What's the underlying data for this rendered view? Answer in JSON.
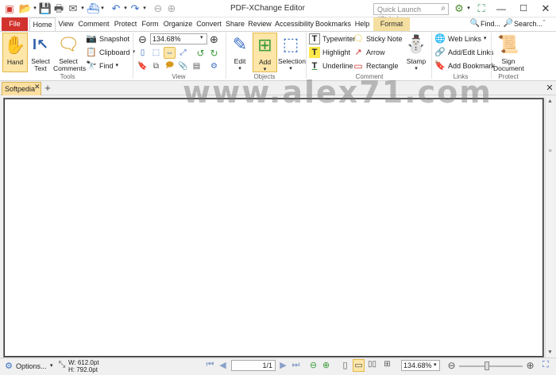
{
  "app": {
    "title": "PDF-XChange Editor"
  },
  "search": {
    "placeholder": "Quick Launch (Ctrl+.)"
  },
  "tabs": [
    "File",
    "Home",
    "View",
    "Comment",
    "Protect",
    "Form",
    "Organize",
    "Convert",
    "Share",
    "Review",
    "Accessibility",
    "Bookmarks",
    "Help",
    "Format"
  ],
  "top_right": {
    "find": "Find...",
    "search": "Search..."
  },
  "groups": {
    "tools": "Tools",
    "view": "View",
    "objects": "Objects",
    "comment": "Comment",
    "links": "Links",
    "protect": "Protect"
  },
  "tools": {
    "hand": "Hand",
    "select_text_1": "Select",
    "select_text_2": "Text",
    "select_comments_1": "Select",
    "select_comments_2": "Comments",
    "snapshot": "Snapshot",
    "clipboard": "Clipboard",
    "find": "Find"
  },
  "view": {
    "zoom": "134.68%"
  },
  "objects": {
    "edit": "Edit",
    "add": "Add",
    "selection": "Selection"
  },
  "comment": {
    "typewriter": "Typewriter",
    "sticky_note": "Sticky Note",
    "highlight": "Highlight",
    "arrow": "Arrow",
    "underline": "Underline",
    "rectangle": "Rectangle",
    "stamp": "Stamp"
  },
  "links": {
    "web_links": "Web Links",
    "add_edit_links": "Add/Edit Links",
    "add_bookmark": "Add Bookmark"
  },
  "protect": {
    "sign_1": "Sign",
    "sign_2": "Document"
  },
  "document": {
    "tab_name": "Softpedia"
  },
  "watermark": "www.alex71.com",
  "status": {
    "options": "Options...",
    "width": "W: 612.0pt",
    "height": "H: 792.0pt",
    "page": "1/1",
    "zoom": "134.68%"
  },
  "colors": {
    "file_tab": "#d2332d",
    "format_tab": "#f5dfa0",
    "doc_tab": "#fcdfa0",
    "hand_active": "#fde6a8"
  }
}
